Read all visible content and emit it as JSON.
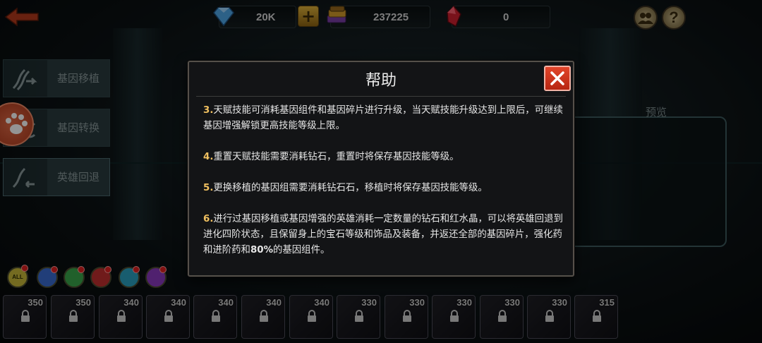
{
  "top_bar": {
    "gems": "20K",
    "books": "237225",
    "crystals": "0",
    "add_symbol": "+",
    "help_symbol": "?"
  },
  "left_menu": [
    {
      "label": "基因移植",
      "icon": "dna-transfer-icon"
    },
    {
      "label": "基因转换",
      "icon": "dna-convert-icon"
    },
    {
      "label": "英雄回退",
      "icon": "dna-revert-icon"
    }
  ],
  "preview": {
    "title": "预览"
  },
  "filters": [
    {
      "label": "ALL",
      "color": "#c8b93a"
    },
    {
      "label": "",
      "color": "#3a6bd0"
    },
    {
      "label": "",
      "color": "#3aa54a"
    },
    {
      "label": "",
      "color": "#c23030"
    },
    {
      "label": "",
      "color": "#2aa0c0"
    },
    {
      "label": "",
      "color": "#8a3ac0"
    }
  ],
  "heroes": [
    {
      "level": "350"
    },
    {
      "level": "350"
    },
    {
      "level": "340"
    },
    {
      "level": "340"
    },
    {
      "level": "340"
    },
    {
      "level": "340"
    },
    {
      "level": "340"
    },
    {
      "level": "330"
    },
    {
      "level": "330"
    },
    {
      "level": "330"
    },
    {
      "level": "330"
    },
    {
      "level": "330"
    },
    {
      "level": "315"
    }
  ],
  "dialog": {
    "title": "帮助",
    "paragraphs": [
      {
        "num": "3.",
        "text": "天赋技能可消耗基因组件和基因碎片进行升级，当天赋技能升级达到上限后，可继续基因增强解锁更高技能等级上限。"
      },
      {
        "num": "4.",
        "text": "重置天赋技能需要消耗钻石，重置时将保存基因技能等级。"
      },
      {
        "num": "5.",
        "text": "更换移植的基因组需要消耗钻石石，移植时将保存基因技能等级。"
      },
      {
        "num": "6.",
        "text_before": "进行过基因移植或基因增强的英雄消耗一定数量的钻石和红水晶，可以将英雄回退到进化四阶状态，且保留身上的宝石等级和饰品及装备，并返还全部的基因碎片，强化药和进阶药和",
        "highlight": "80%",
        "text_after": "的基因组件。"
      }
    ]
  },
  "colors": {
    "accent_gold": "#f0c060",
    "close_red": "#d3361e",
    "panel_bg": "#131416"
  }
}
